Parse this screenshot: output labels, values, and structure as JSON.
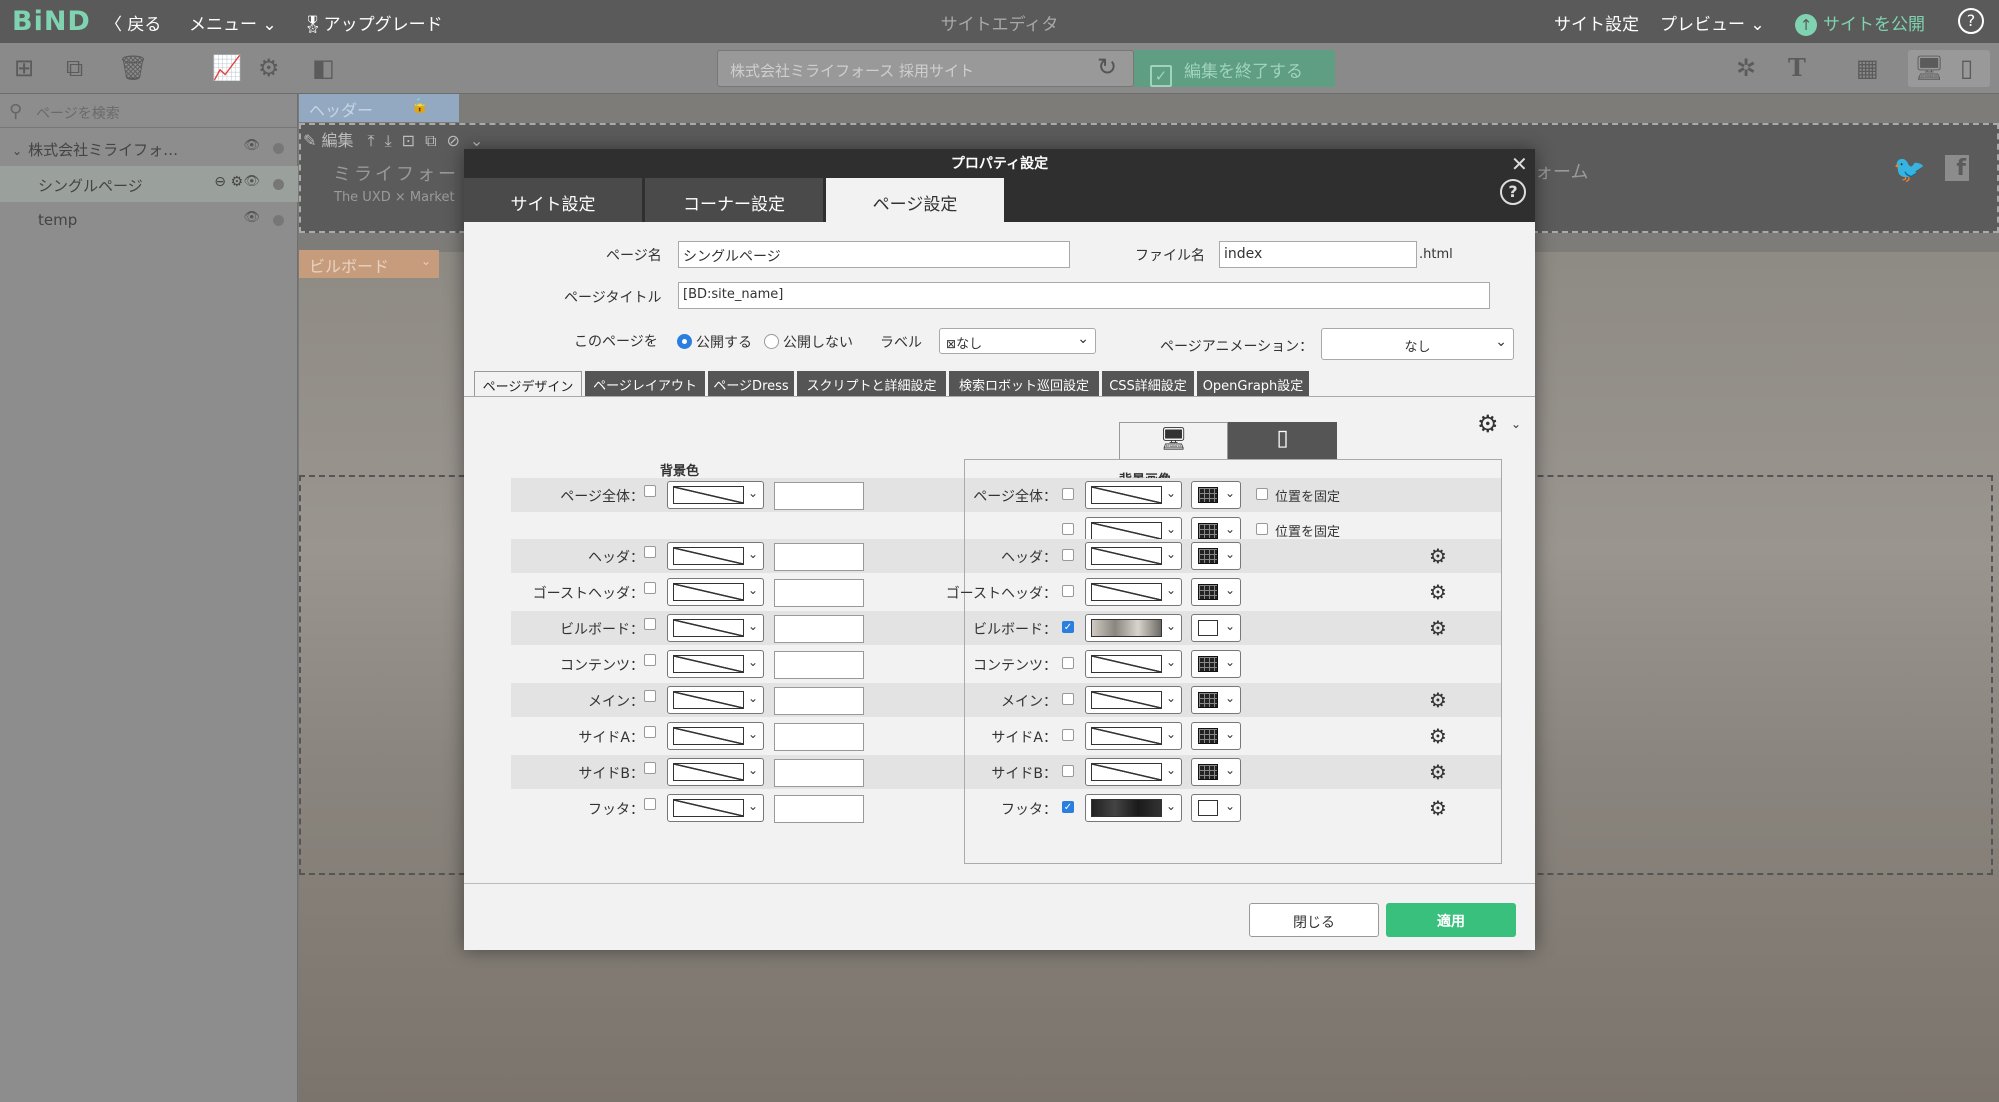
{
  "topbar": {
    "logo": "BiND",
    "back": "〈 戻る",
    "menu": "メニュー ⌄",
    "upgrade": "アップグレード",
    "editor_title": "サイトエディタ",
    "site_settings": "サイト設定",
    "preview": "プレビュー ⌄",
    "publish": "サイトを公開",
    "help": "?"
  },
  "toolbar": {
    "url": "株式会社ミライフォース 採用サイト",
    "finish": "編集を終了する"
  },
  "leftpanel": {
    "search_placeholder": "ページを検索",
    "tree": [
      {
        "label": "株式会社ミライフォ…"
      },
      {
        "label": "シングルページ"
      },
      {
        "label": "temp"
      }
    ]
  },
  "canvas": {
    "header_tab": "ヘッダー",
    "billboard_tab": "ビルボード",
    "edit_label": "編集",
    "site_name_fragment": "ミライフォー",
    "tagline_fragment": "The UXD × Market",
    "form_fragment": "ォーム"
  },
  "dialog": {
    "title": "プロパティ設定",
    "tabs": [
      "サイト設定",
      "コーナー設定",
      "ページ設定"
    ],
    "page_name_label": "ページ名",
    "page_name": "シングルページ",
    "file_name_label": "ファイル名",
    "file_name": "index",
    "file_ext": ".html",
    "page_title_label": "ページタイトル",
    "page_title": "[BD:site_name]",
    "this_page_label": "このページを",
    "publish_on": "公開する",
    "publish_off": "公開しない",
    "label_label": "ラベル",
    "label_value": "なし",
    "animation_label": "ページアニメーション：",
    "animation_value": "なし",
    "subtabs": [
      "ページデザイン",
      "ページレイアウト",
      "ページDress",
      "スクリプトと詳細設定",
      "検索ロボット巡回設定",
      "CSS詳細設定",
      "OpenGraph設定"
    ],
    "bgcolor_heading": "背景色",
    "bgimage_heading": "背景画像",
    "fix_position": "位置を固定",
    "left_rows": [
      "ページ全体：",
      "ヘッダ：",
      "ゴーストヘッダ：",
      "ビルボード：",
      "コンテンツ：",
      "メイン：",
      "サイドA：",
      "サイドB：",
      "フッタ："
    ],
    "right_rows": [
      "ページ全体：",
      "",
      "ヘッダ：",
      "ゴーストヘッダ：",
      "ビルボード：",
      "コンテンツ：",
      "メイン：",
      "サイドA：",
      "サイドB：",
      "フッタ："
    ],
    "close": "閉じる",
    "apply": "適用"
  }
}
